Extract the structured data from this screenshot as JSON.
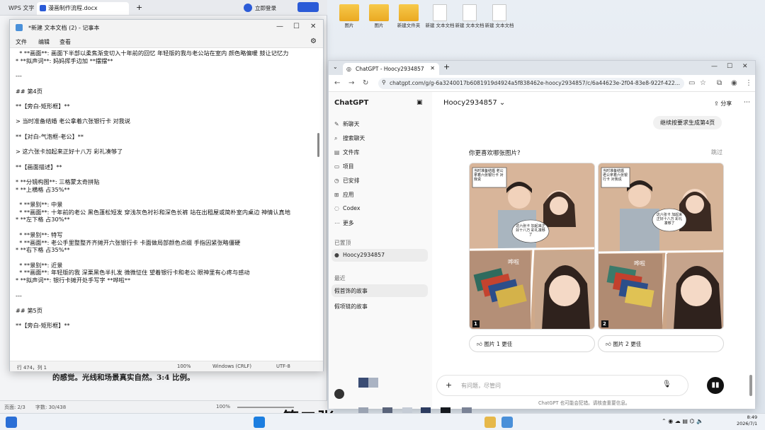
{
  "wps": {
    "tabs": [
      "WPS 文字",
      "漫画制作流程.docx"
    ],
    "login": "立即登录",
    "doc_line": "的感觉。光线和场景真实自然。3:4 比例。",
    "status": {
      "page": "页面: 2/3",
      "words": "字数: 30/438",
      "zoom": "100%"
    }
  },
  "desktop": {
    "icons": [
      "图片",
      "图片",
      "新建文件夹",
      "新建 文本文档",
      "新建 文本文档",
      "新建 文本文档"
    ]
  },
  "notepad": {
    "title": "*新建 文本文档 (2) - 记事本",
    "menu": [
      "文件",
      "编辑",
      "查看"
    ],
    "lines": [
      "  * **画面**: 画面下半部以柔焦渐变切入十年前的回忆 年轻版的我与老公站在室内 颜色略偏暖 鼓让记忆力",
      "* **拟声词**: 妈妈挥手边加 **摆摆**",
      "",
      "---",
      "",
      "## 第4页",
      "",
      "**【旁白-矩形框】**",
      "",
      "> 当时准备结婚 老公拿着六张银行卡 对我说",
      "",
      "**【对白-气泡框-老公】**",
      "",
      "> 这六张卡加起来正好十八万 彩礼凑够了",
      "",
      "**【画面描述】**",
      "",
      "* **分镜构图**: 三格蒙太奇拼贴",
      "* **上横格 占35%**",
      "",
      "  * **景别**: 中景",
      "  * **画面**: 十年前的老公 黑色蓬松短发 穿浅灰色衬衫和深色长裤 站在出租屋或简朴室内桌边 神情认真地",
      "* **左下格 占30%**",
      "",
      "  * **景别**: 特写",
      "  * **画面**: 老公手里整整齐齐摊开六张银行卡 卡面做局部颜色点缀 手指因紧张略僵硬",
      "* **右下格 占35%**",
      "",
      "  * **景别**: 近景",
      "  * **画面**: 年轻版的我 深栗黑色半扎发 微微怔住 望着银行卡和老公 眼神里有心疼与感动",
      "* **拟声词**: 银行卡摊开处手写字 **哗啦**",
      "",
      "---",
      "",
      "## 第5页",
      "",
      "**【旁白-矩形框】**"
    ],
    "status": {
      "pos": "行 474，列 1",
      "zoom": "100%",
      "eol": "Windows (CRLF)",
      "enc": "UTF-8"
    }
  },
  "chrome": {
    "tab_title": "ChatGPT - Hoocy2934857",
    "url": "chatgpt.com/g/g-6a3240017b6081919d4924a5f838462e-hoocy2934857/c/6a44623e-2f04-83e8-922f-422...",
    "sidebar": {
      "brand": "ChatGPT",
      "items": [
        "新聊天",
        "搜索聊天",
        "文件库",
        "项目",
        "已安排",
        "应用",
        "Codex",
        "更多"
      ],
      "pinned_label": "已置顶",
      "pinned": "Hoocy2934857",
      "recent_label": "最近",
      "recent": [
        "假首饰的故事",
        "假项链的故事"
      ]
    },
    "main": {
      "model": "Hoocy2934857",
      "share": "分享",
      "user_msg": "继续按要求生成第4页",
      "question": "你更喜欢哪张图片?",
      "skip": "跳过",
      "images": [
        {
          "num": "1",
          "top_text": "当时准备结婚 老公拿着六张银行卡 对我说",
          "bubble": "这六张卡 加起来正好十八万 彩礼凑够了",
          "sfx": "哗啦",
          "pick": "图片 1 更佳"
        },
        {
          "num": "2",
          "top_text": "当时准备结婚 老公拿着六张银行卡 对我说",
          "bubble": "这六张卡 加起来正好十八万 彩礼凑够了",
          "sfx": "哗啦",
          "pick": "图片 2 更佳"
        }
      ],
      "composer_placeholder": "有问题，尽管问",
      "footer": "ChatGPT 也可能会犯错。请核查重要信息。"
    }
  },
  "caption": "第二张",
  "taskbar": {
    "time": "8:49",
    "date": "2026/7/1"
  },
  "colors": {
    "accent": "#1a73e8",
    "wps_blue": "#2b5bd7"
  }
}
